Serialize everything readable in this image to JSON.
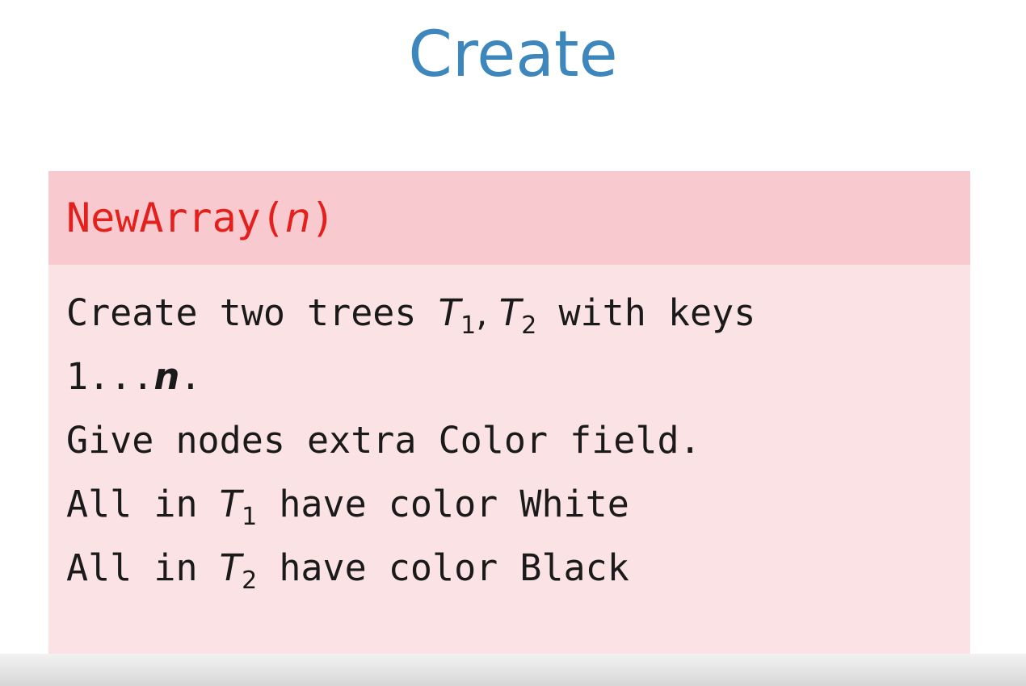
{
  "slide": {
    "title": "Create"
  },
  "block": {
    "title_prefix": "NewArray(",
    "title_var": "n",
    "title_suffix": ")",
    "line1": {
      "before": "Create two trees ",
      "t1": "T",
      "t1_sub": "1",
      "comma": ", ",
      "t2": "T",
      "t2_sub": "2",
      "after": " with keys"
    },
    "line2": {
      "before": "1...",
      "var": "n",
      "after": "."
    },
    "line3": "Give nodes extra Color field.",
    "line4": {
      "before": "All in ",
      "t": "T",
      "sub": "1",
      "after": " have color White"
    },
    "line5": {
      "before": "All in ",
      "t": "T",
      "sub": "2",
      "after": " have color Black"
    }
  }
}
